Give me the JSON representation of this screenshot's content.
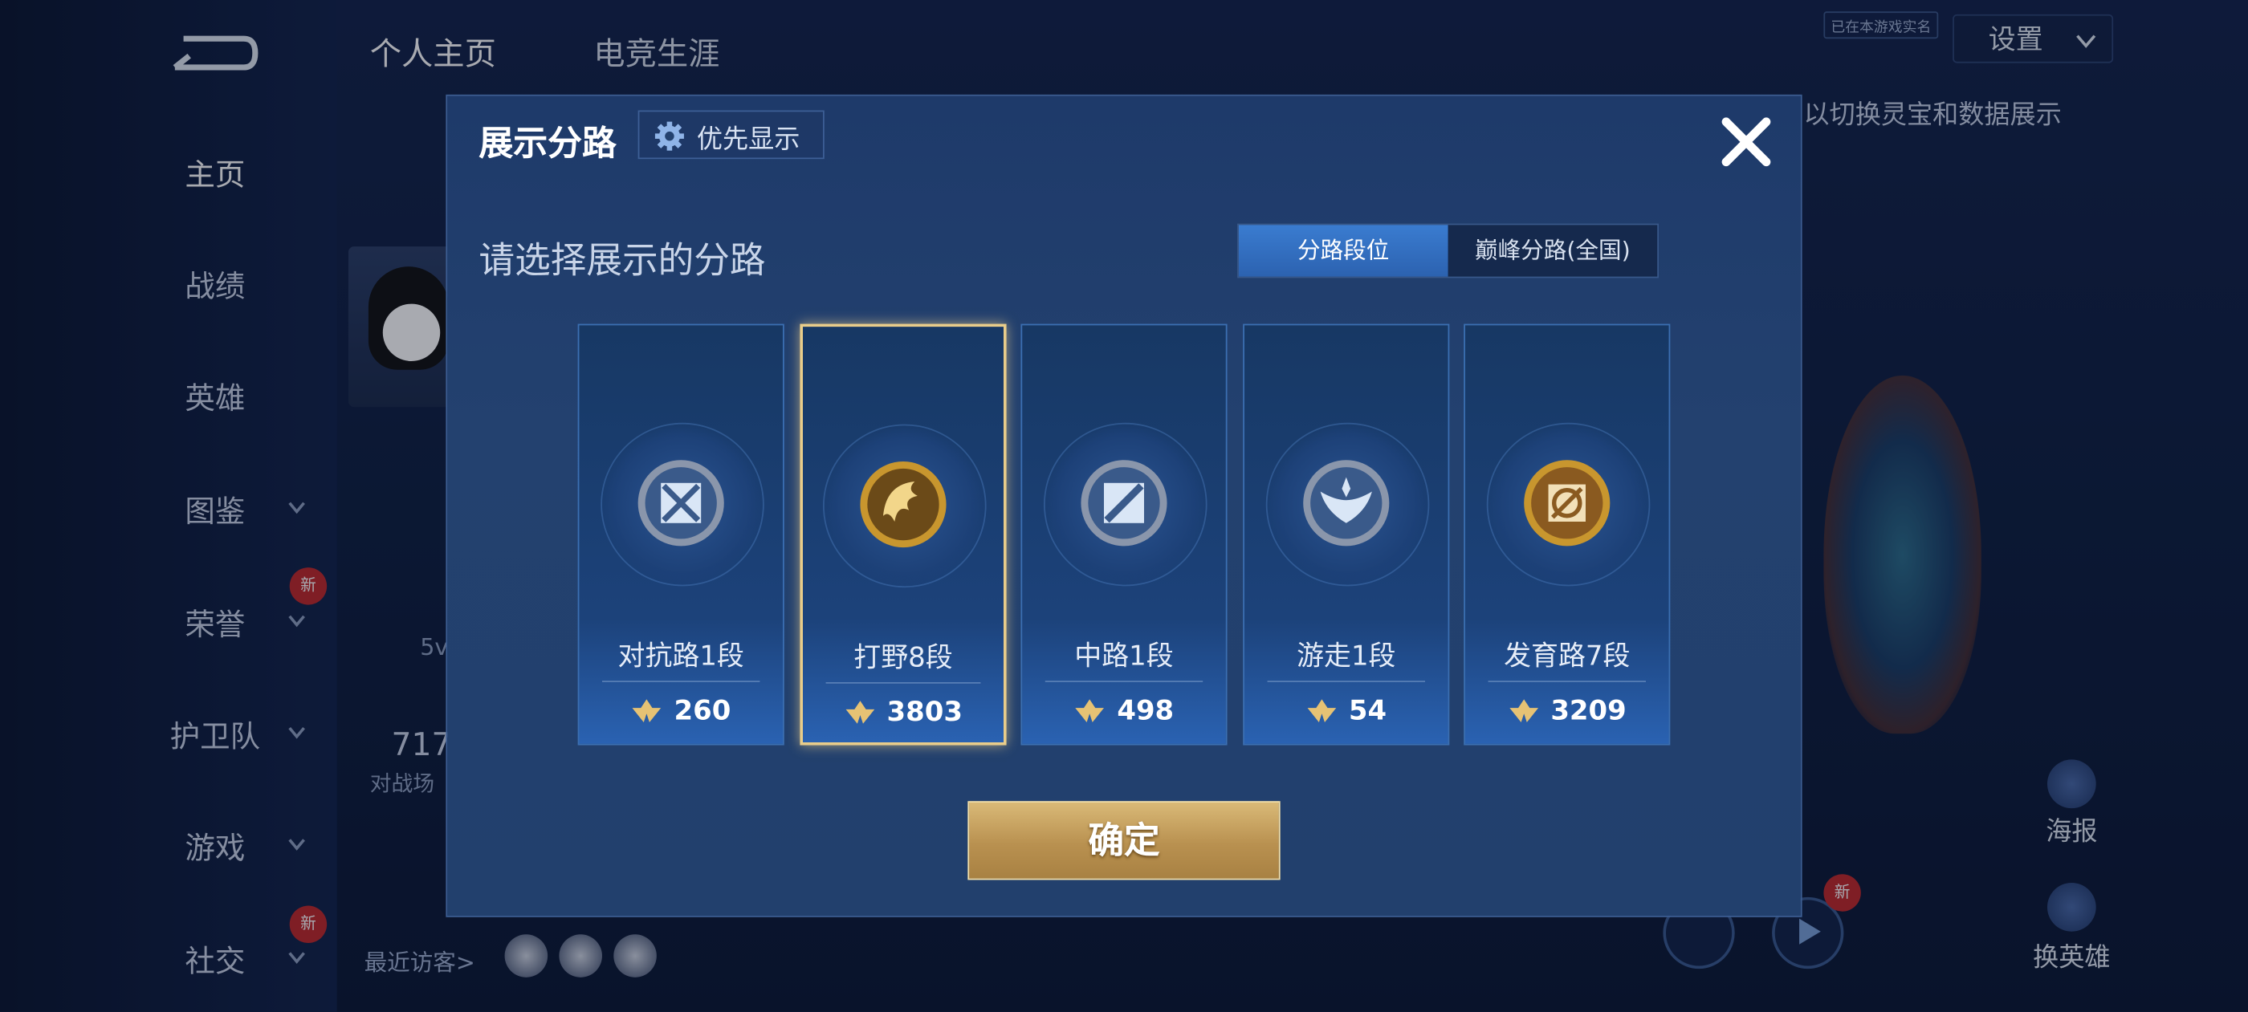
{
  "sidebar": {
    "items": [
      {
        "label": "主页"
      },
      {
        "label": "战绩"
      },
      {
        "label": "英雄"
      },
      {
        "label": "图鉴"
      },
      {
        "label": "荣誉"
      },
      {
        "label": "护卫队"
      },
      {
        "label": "游戏"
      },
      {
        "label": "社交"
      }
    ],
    "new_badge": "新"
  },
  "header": {
    "tabs": [
      "个人主页",
      "电竞生涯"
    ],
    "settings_label": "设置",
    "tiny_label": "已在本游戏实名"
  },
  "background": {
    "hint_text": "以切换灵宝和数据展示",
    "stat_number": "717",
    "stat_label": "对战场",
    "mode_text": "5v",
    "visitors_label": "最近访客>",
    "poster_label": "海报",
    "change_hero_label": "换英雄"
  },
  "modal": {
    "title": "展示分路",
    "priority_label": "优先显示",
    "subtitle": "请选择展示的分路",
    "toggle": [
      "分路段位",
      "巅峰分路(全国)"
    ],
    "toggle_selected": 0,
    "lanes": [
      {
        "name": "对抗路1段",
        "score": "260",
        "badge": "clash-lane-badge-icon",
        "selected": false
      },
      {
        "name": "打野8段",
        "score": "3803",
        "badge": "jungle-badge-icon",
        "selected": true
      },
      {
        "name": "中路1段",
        "score": "498",
        "badge": "mid-lane-badge-icon",
        "selected": false
      },
      {
        "name": "游走1段",
        "score": "54",
        "badge": "roam-badge-icon",
        "selected": false
      },
      {
        "name": "发育路7段",
        "score": "3209",
        "badge": "farm-lane-badge-icon",
        "selected": false
      }
    ],
    "confirm_label": "确定"
  },
  "colors": {
    "accent_gold": "#e9cd8a",
    "toggle_active": "#3a7cd0",
    "modal_bg": "#22406d"
  }
}
